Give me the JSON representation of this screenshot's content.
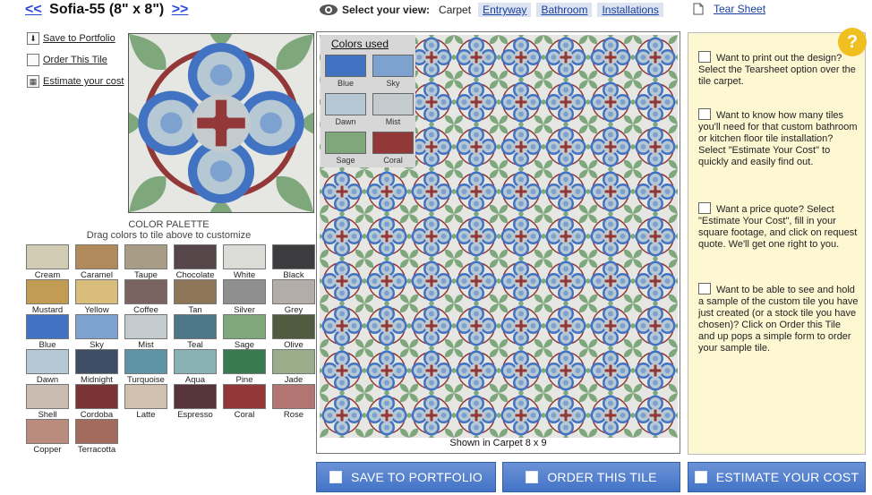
{
  "header": {
    "prev": "<<",
    "title": "Sofia-55 (8\" x 8\")",
    "next": ">>",
    "view_label": "Select your view:",
    "current_view": "Carpet",
    "views": [
      "Entryway",
      "Bathroom",
      "Installations"
    ],
    "tear_sheet": "Tear Sheet"
  },
  "links": {
    "save": "Save to Portfolio",
    "order": "Order This Tile",
    "estimate": "Estimate your cost"
  },
  "palette": {
    "title": "COLOR PALETTE",
    "subtitle": "Drag colors to tile above to customize",
    "colors": [
      {
        "name": "Cream",
        "hex": "#d3ccb5"
      },
      {
        "name": "Caramel",
        "hex": "#b08a5a"
      },
      {
        "name": "Taupe",
        "hex": "#a99c86"
      },
      {
        "name": "Chocolate",
        "hex": "#56464a"
      },
      {
        "name": "White",
        "hex": "#dbdcd7"
      },
      {
        "name": "Black",
        "hex": "#3c3c3e"
      },
      {
        "name": "Mustard",
        "hex": "#c29c52"
      },
      {
        "name": "Yellow",
        "hex": "#d9bd7c"
      },
      {
        "name": "Coffee",
        "hex": "#7a6462"
      },
      {
        "name": "Tan",
        "hex": "#8e7658"
      },
      {
        "name": "Silver",
        "hex": "#8f8f8f"
      },
      {
        "name": "Grey",
        "hex": "#b2ada8"
      },
      {
        "name": "Blue",
        "hex": "#4273c3"
      },
      {
        "name": "Sky",
        "hex": "#7da2d0"
      },
      {
        "name": "Mist",
        "hex": "#c3cbcf"
      },
      {
        "name": "Teal",
        "hex": "#4d7789"
      },
      {
        "name": "Sage",
        "hex": "#7ea77c"
      },
      {
        "name": "Olive",
        "hex": "#505a3e"
      },
      {
        "name": "Dawn",
        "hex": "#b6c8d3"
      },
      {
        "name": "Midnight",
        "hex": "#3e4c66"
      },
      {
        "name": "Turquoise",
        "hex": "#5f93a6"
      },
      {
        "name": "Aqua",
        "hex": "#89b2b4"
      },
      {
        "name": "Pine",
        "hex": "#3a7a4f"
      },
      {
        "name": "Jade",
        "hex": "#9aae8c"
      },
      {
        "name": "Shell",
        "hex": "#cbbcb2"
      },
      {
        "name": "Cordoba",
        "hex": "#7a3436"
      },
      {
        "name": "Latte",
        "hex": "#cfc0af"
      },
      {
        "name": "Espresso",
        "hex": "#57333a"
      },
      {
        "name": "Coral",
        "hex": "#923838"
      },
      {
        "name": "Rose",
        "hex": "#b27572"
      },
      {
        "name": "Copper",
        "hex": "#b98c7e"
      },
      {
        "name": "Terracotta",
        "hex": "#a36b5d"
      }
    ]
  },
  "colors_used": {
    "title": "Colors used",
    "items": [
      {
        "name": "Blue",
        "hex": "#4273c3"
      },
      {
        "name": "Sky",
        "hex": "#7da2d0"
      },
      {
        "name": "Dawn",
        "hex": "#b6c8d3"
      },
      {
        "name": "Mist",
        "hex": "#c3cbcf"
      },
      {
        "name": "Sage",
        "hex": "#7ea77c"
      },
      {
        "name": "Coral",
        "hex": "#923838"
      }
    ]
  },
  "carpet": {
    "caption": "Shown in Carpet 8 x 9"
  },
  "help": {
    "badge": "?",
    "tips": [
      "Want to print out the design? Select the Tearsheet option over the tile carpet.",
      "Want to know how many tiles you'll need for that custom bathroom or kitchen floor tile installation? Select \"Estimate Your Cost\" to quickly and easily find out.",
      "Want a price quote? Select \"Estimate Your Cost\", fill in your square footage, and click on request quote. We'll get one right to you.",
      "Want to be able to see and hold a sample of the custom tile you have just created (or a stock tile you have chosen)? Click on Order this Tile and up pops a simple form to order your sample tile."
    ]
  },
  "buttons": {
    "save": "SAVE TO PORTFOLIO",
    "order": "ORDER THIS TILE",
    "estimate": "ESTIMATE YOUR COST"
  }
}
